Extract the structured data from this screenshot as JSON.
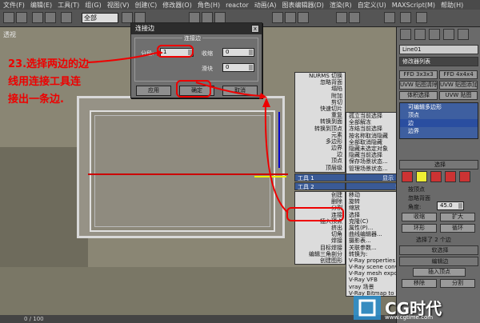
{
  "menu": [
    "文件(F)",
    "编辑(E)",
    "工具(T)",
    "组(G)",
    "视图(V)",
    "创建(C)",
    "修改器(O)",
    "角色(H)",
    "reactor",
    "动画(A)",
    "图表编辑器(D)",
    "渲染(R)",
    "自定义(U)",
    "MAXScript(M)",
    "帮助(H)"
  ],
  "toolbar": {
    "selection_filter": "全部"
  },
  "viewport": {
    "label": "透视",
    "status_frame": "0 / 100"
  },
  "dialog": {
    "title": "连接边",
    "group_title": "连接边",
    "segments_label": "分段:",
    "segments_value": "1",
    "pinch_label": "收缩",
    "pinch_value": "0",
    "slide_label": "滑块",
    "slide_value": "0",
    "apply_label": "应用",
    "ok_label": "确定",
    "cancel_label": "取消"
  },
  "annotation": [
    "23.选择两边的边",
    "线用连接工具连",
    "接出一条边."
  ],
  "quad_menu_left": {
    "tools1_header": "工具 1",
    "tools2_header": "工具 2",
    "items_top": [
      "NURMS 切换",
      "忽略背面",
      "塌陷",
      "附加",
      "剪切",
      "快速切片",
      "重复",
      "转换到面",
      "转换到顶点",
      "元素",
      "多边形",
      "边界",
      "边",
      "顶点",
      "顶层级"
    ],
    "items_bottom": [
      "创建",
      "删除",
      "分割",
      "连接",
      "插入顶点",
      "挤出",
      "切角",
      "焊接",
      "目标焊接",
      "编辑三角剖分",
      "创建图形"
    ]
  },
  "quad_menu_right": {
    "display_header": "显示",
    "transform_header": "变换",
    "items_top": [
      "孤立当前选择",
      "全部解冻",
      "冻结当前选择",
      "按名称取消隐藏",
      "全部取消隐藏",
      "隐藏未选定对象",
      "隐藏当前选择",
      "保存场景状态...",
      "管理场景状态..."
    ],
    "items_bottom": [
      "移动",
      "旋转",
      "缩放",
      "选择",
      "克隆(C)",
      "属性(P)...",
      "曲线编辑器...",
      "摄影表...",
      "关联参数...",
      "转换为:",
      "V-Ray properties",
      "V-Ray scene converter",
      "V-Ray mesh export",
      "V-Ray VFB",
      "vray 场景",
      "V-Ray Bitmap to VRayHDRI converter"
    ]
  },
  "command_panel": {
    "object_name": "Line01",
    "modifier_list": "修改器列表",
    "btn_ffd333": "FFD 3x3x3",
    "btn_ffd444": "FFD 4x4x4",
    "btn_uvw_clear": "UVW 贴图清除",
    "btn_uvw_add": "UVW 贴图添加",
    "btn_vol_sel": "体积选择",
    "btn_uvw_map": "UVW 贴图",
    "stack": [
      "可编辑多边形",
      "顶点",
      "边",
      "边界"
    ],
    "selection_title": "选择",
    "by_vertex": "按顶点",
    "ignore_back": "忽略背面",
    "angle_label": "角度:",
    "angle_value": "45.0",
    "shrink": "收缩",
    "grow": "扩大",
    "ring": "环形",
    "loop": "循环",
    "selected_info": "选择了 2 个边",
    "soft_sel": "软选择",
    "edit_edges": "编辑边",
    "insert_vertex": "插入顶点",
    "remove": "移除",
    "split": "分割"
  },
  "logo": {
    "text": "CG时代",
    "url": "www.cgtime.com"
  },
  "colors": {
    "annotation_red": "#ee0000",
    "selection_blue": "#3a5a96"
  }
}
